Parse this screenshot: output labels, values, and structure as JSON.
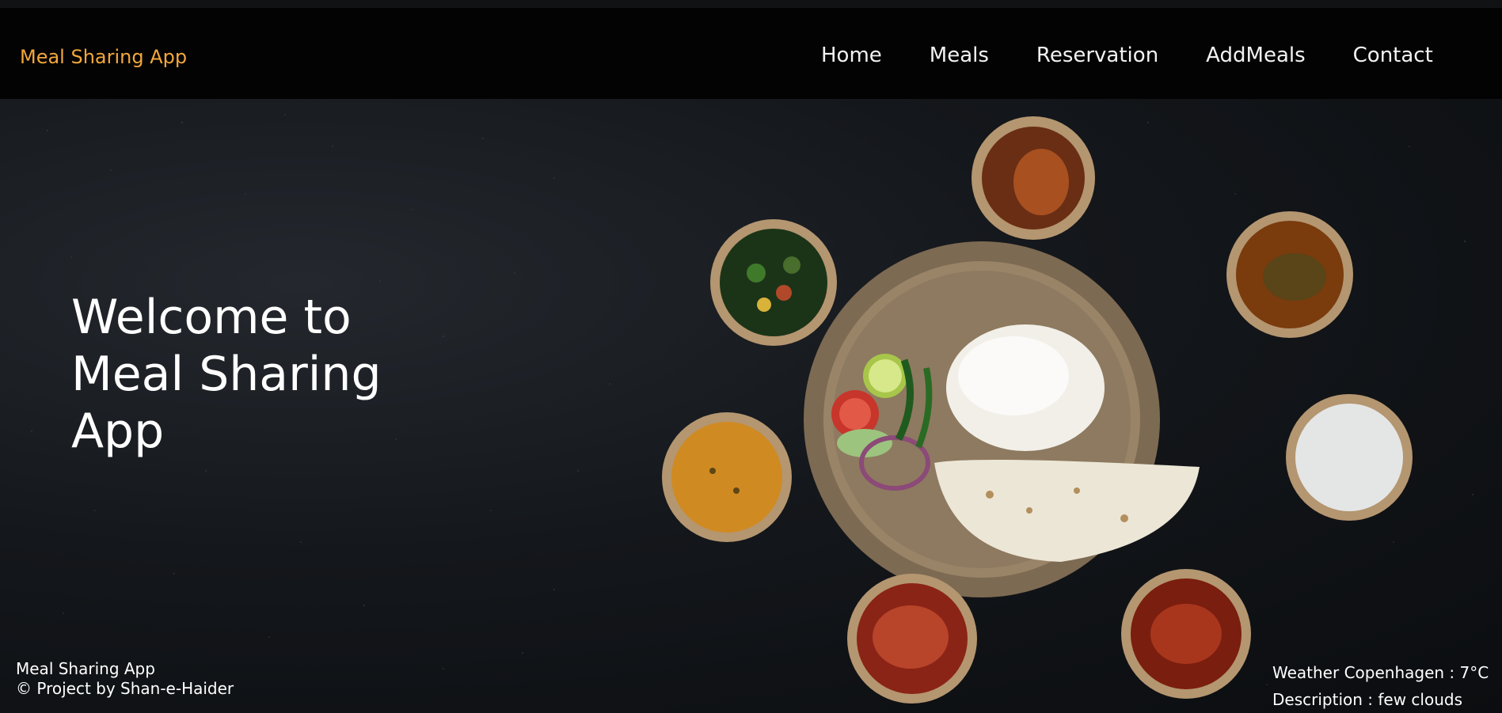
{
  "navbar": {
    "brand": "Meal Sharing App",
    "links": [
      "Home",
      "Meals",
      "Reservation",
      "AddMeals",
      "Contact"
    ]
  },
  "hero": {
    "title_lines": [
      "Welcome to",
      "Meal Sharing",
      "App"
    ]
  },
  "footer": {
    "app_name": "Meal Sharing App",
    "copyright": "© Project by Shan-e-Haider",
    "weather": "Weather Copenhagen : 7°C",
    "description": "Description : few clouds"
  },
  "colors": {
    "brand": "#f3a73b",
    "navbar_bg": "#030303",
    "hero_bg": "#14171b",
    "text": "#ffffff"
  }
}
